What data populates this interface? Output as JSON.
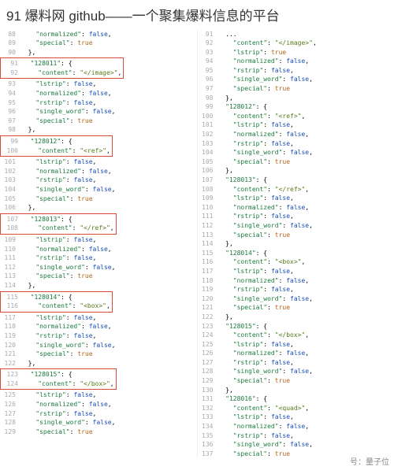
{
  "header": {
    "title": "91 爆料网 github——一个聚集爆料信息的平台"
  },
  "footer_attrib": "号：量子位",
  "labels": {
    "normalized": "normalized",
    "special": "special",
    "content": "content",
    "lstrip": "lstrip",
    "rstrip": "rstrip",
    "single_word": "single_word"
  },
  "tokens": {
    "false": "false",
    "true": "true"
  },
  "left_tail": {
    "lines": [
      "88",
      "89",
      "90"
    ],
    "normalized_line": "\"normalized\": false,",
    "special_line": "\"special\": true"
  },
  "left_blocks": [
    {
      "line_start": 91,
      "key": "128011",
      "content": "</image>"
    },
    {
      "line_start": 99,
      "key": "128012",
      "content": "<ref>"
    },
    {
      "line_start": 107,
      "key": "128013",
      "content": "</ref>"
    },
    {
      "line_start": 115,
      "key": "128014",
      "content": "<box>"
    },
    {
      "line_start": 123,
      "key": "128015",
      "content": "</box>"
    }
  ],
  "right_tail": {
    "lines": [
      "91",
      "92",
      "93",
      "94",
      "95",
      "96",
      "97",
      "98"
    ],
    "content": "</image>"
  },
  "right_blocks": [
    {
      "line_start": 99,
      "key": "128012",
      "content": "<ref>"
    },
    {
      "line_start": 107,
      "key": "128013",
      "content": "</ref>"
    },
    {
      "line_start": 115,
      "key": "128014",
      "content": "<box>"
    },
    {
      "line_start": 123,
      "key": "128015",
      "content": "</box>"
    },
    {
      "line_start": 131,
      "key": "128016",
      "content": "<quad>"
    }
  ]
}
